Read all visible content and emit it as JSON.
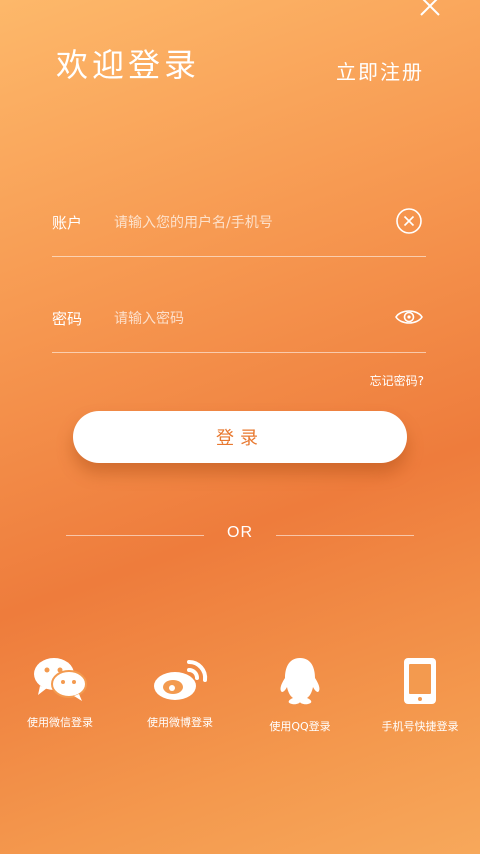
{
  "header": {
    "title": "欢迎登录",
    "register_label": "立即注册"
  },
  "account": {
    "label": "账户",
    "placeholder": "请输入您的用户名/手机号"
  },
  "password": {
    "label": "密码",
    "placeholder": "请输入密码"
  },
  "forgot_label": "忘记密码?",
  "login_label": "登录",
  "divider_label": "OR",
  "social": [
    {
      "label": "使用微信登录",
      "icon": "wechat-icon"
    },
    {
      "label": "使用微博登录",
      "icon": "weibo-icon"
    },
    {
      "label": "使用QQ登录",
      "icon": "qq-icon"
    },
    {
      "label": "手机号快捷登录",
      "icon": "phone-icon"
    }
  ],
  "colors": {
    "accent": "#e8782f",
    "background_top": "#fdb86a",
    "background_mid": "#ee7c3c"
  }
}
